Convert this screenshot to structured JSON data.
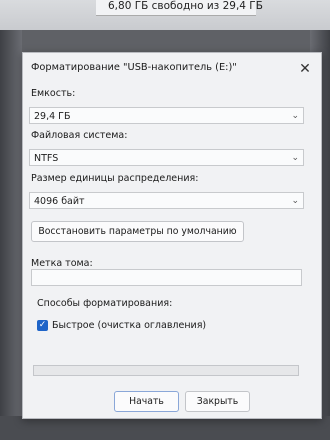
{
  "background": {
    "free_space_text": "6,80 ГБ свободно из 29,4 ГБ"
  },
  "dialog": {
    "title": "Форматирование \"USB-накопитель (E:)\"",
    "close_glyph": "✕",
    "capacity": {
      "label": "Емкость:",
      "value": "29,4 ГБ"
    },
    "file_system": {
      "label": "Файловая система:",
      "value": "NTFS"
    },
    "allocation_unit": {
      "label": "Размер единицы распределения:",
      "value": "4096 байт"
    },
    "restore_defaults_label": "Восстановить параметры по умолчанию",
    "volume_label": {
      "label": "Метка тома:",
      "value": ""
    },
    "format_options": {
      "label": "Способы форматирования:",
      "quick_format": {
        "label": "Быстрое (очистка оглавления)",
        "checked": true
      }
    },
    "progress": 0,
    "start_label": "Начать",
    "close_label": "Закрыть"
  }
}
